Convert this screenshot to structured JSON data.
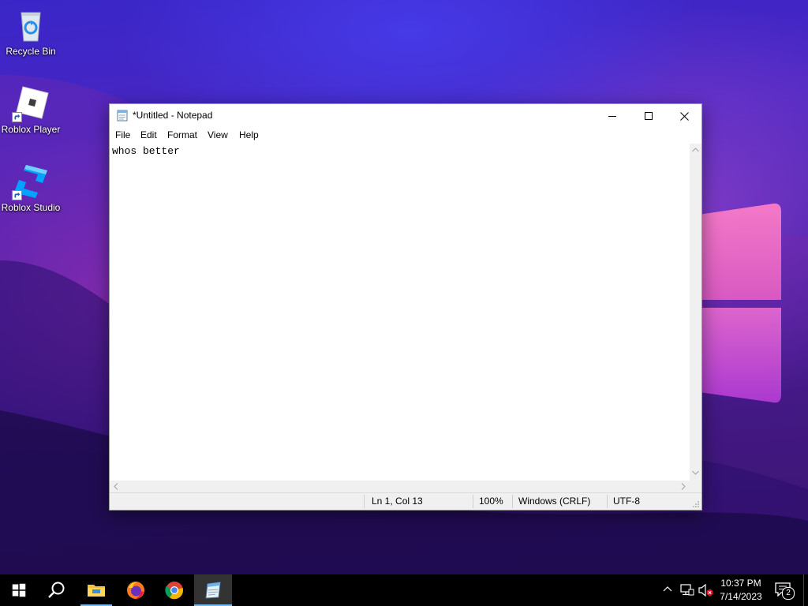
{
  "desktop": {
    "icons": [
      {
        "label": "Recycle Bin",
        "icon": "recycle-bin-icon"
      },
      {
        "label": "Roblox Player",
        "icon": "roblox-player-icon"
      },
      {
        "label": "Roblox Studio",
        "icon": "roblox-studio-icon"
      }
    ]
  },
  "notepad": {
    "title": "*Untitled - Notepad",
    "menu": [
      "File",
      "Edit",
      "Format",
      "View",
      "Help"
    ],
    "content": "whos better",
    "status": {
      "position": "Ln 1, Col 13",
      "zoom": "100%",
      "line_ending": "Windows (CRLF)",
      "encoding": "UTF-8"
    }
  },
  "taskbar": {
    "apps": [
      "start-icon",
      "search-icon",
      "file-explorer-icon",
      "firefox-icon",
      "chrome-icon",
      "notepad-icon"
    ],
    "clock": {
      "time": "10:37 PM",
      "date": "7/14/2023"
    },
    "notifications": "2"
  },
  "colors": {
    "taskbar": "#000000",
    "accent": "#76b9ed"
  }
}
